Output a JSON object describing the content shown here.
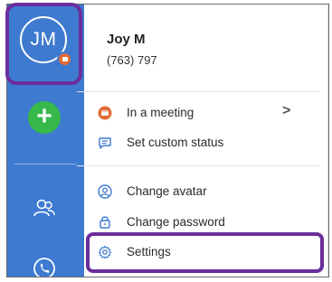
{
  "user": {
    "initials": "JM",
    "name": "Joy M",
    "phone": "(763) 797"
  },
  "sidebar": {
    "add_symbol": "+",
    "icons": [
      "contacts-icon",
      "phone-icon"
    ]
  },
  "menu": {
    "status": {
      "label": "In a meeting",
      "icon": "calendar-busy-icon",
      "has_submenu": true
    },
    "custom_status": {
      "label": "Set custom status",
      "icon": "chat-bubble-icon"
    },
    "change_avatar": {
      "label": "Change avatar",
      "icon": "user-circle-icon"
    },
    "change_password": {
      "label": "Change password",
      "icon": "lock-icon"
    },
    "settings": {
      "label": "Settings",
      "icon": "gear-icon"
    }
  },
  "colors": {
    "sidebar": "#3d7ad0",
    "status_busy": "#e46b37",
    "add_button": "#36b84a",
    "highlight": "#6b2d9a",
    "menu_icon": "#3d7ad0"
  }
}
